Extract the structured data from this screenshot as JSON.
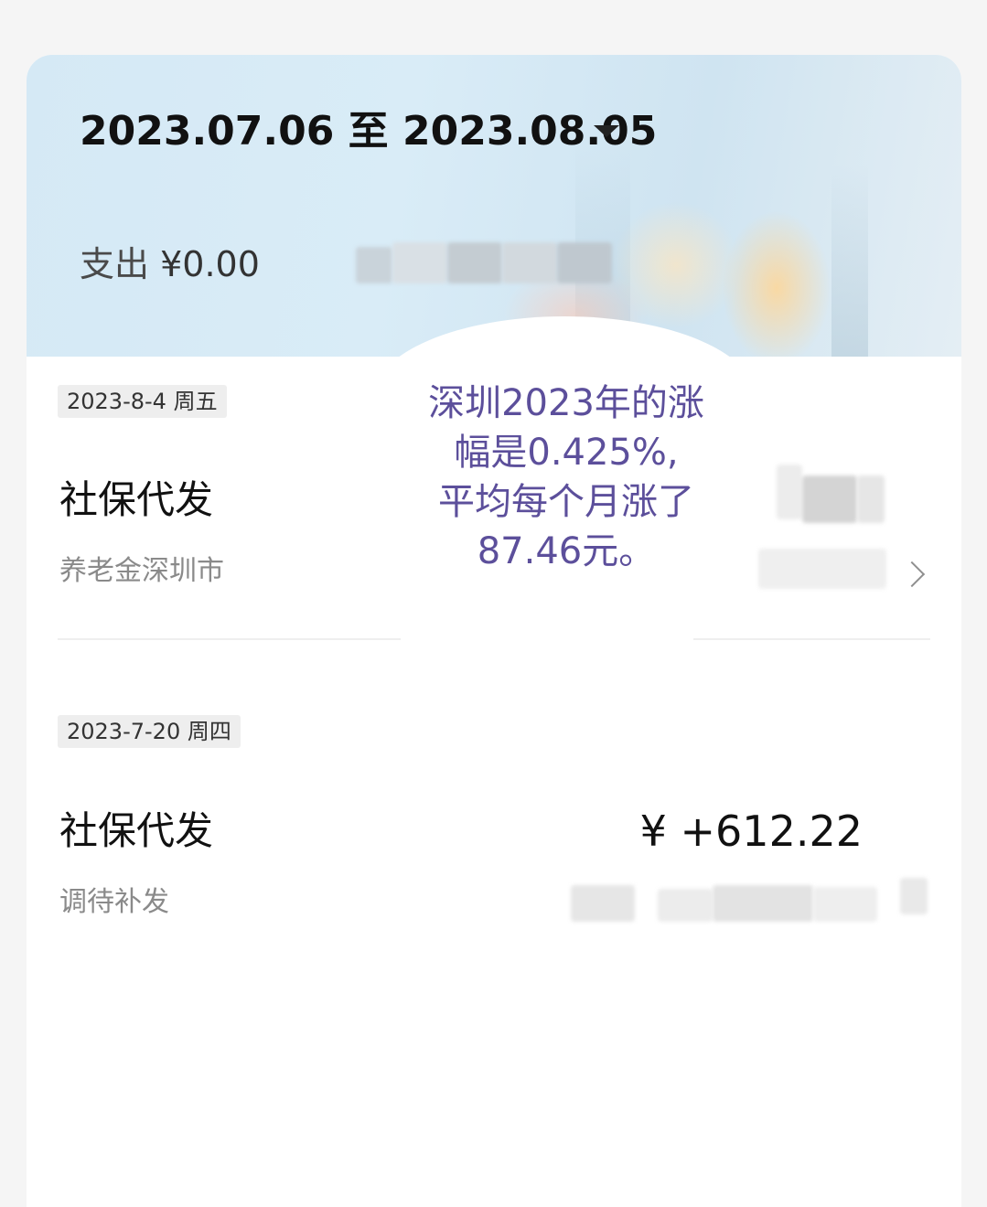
{
  "header": {
    "date_range": "2023.07.06 至 2023.08.05",
    "expense_label": "支出",
    "expense_value": "¥0.00"
  },
  "transactions": [
    {
      "date": "2023-8-4 周五",
      "title": "社保代发",
      "subtitle": "养老金深圳市",
      "amount": ""
    },
    {
      "date": "2023-7-20 周四",
      "title": "社保代发",
      "subtitle": "调待补发",
      "amount": "¥ +612.22"
    }
  ],
  "overlay_note": {
    "lines": [
      "深圳2023年的涨",
      "幅是0.425%,",
      "平均每个月涨了",
      "87.46元。"
    ],
    "color": "#5c4f9b"
  },
  "colors": {
    "header_bg": "#d5e9f5",
    "card_bg": "#ffffff",
    "page_bg": "#f5f5f5"
  }
}
